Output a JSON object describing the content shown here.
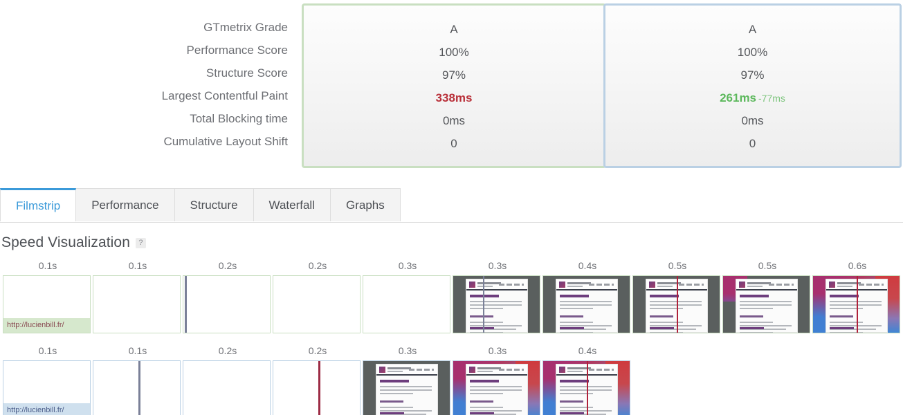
{
  "summary": {
    "metric_labels": [
      "GTmetrix Grade",
      "Performance Score",
      "Structure Score",
      "Largest Contentful Paint",
      "Total Blocking time",
      "Cumulative Layout Shift"
    ],
    "cards": [
      {
        "accent": "#c9dfc1",
        "values": [
          {
            "text": "A",
            "state": "normal",
            "delta": ""
          },
          {
            "text": "100%",
            "state": "normal",
            "delta": ""
          },
          {
            "text": "97%",
            "state": "normal",
            "delta": ""
          },
          {
            "text": "338ms",
            "state": "bad",
            "delta": ""
          },
          {
            "text": "0ms",
            "state": "normal",
            "delta": ""
          },
          {
            "text": "0",
            "state": "normal",
            "delta": ""
          }
        ]
      },
      {
        "accent": "#bad0e4",
        "values": [
          {
            "text": "A",
            "state": "normal",
            "delta": ""
          },
          {
            "text": "100%",
            "state": "normal",
            "delta": ""
          },
          {
            "text": "97%",
            "state": "normal",
            "delta": ""
          },
          {
            "text": "261ms",
            "state": "good",
            "delta": "-77ms"
          },
          {
            "text": "0ms",
            "state": "normal",
            "delta": ""
          },
          {
            "text": "0",
            "state": "normal",
            "delta": ""
          }
        ]
      }
    ]
  },
  "tabs": [
    {
      "label": "Filmstrip",
      "active": true
    },
    {
      "label": "Performance",
      "active": false
    },
    {
      "label": "Structure",
      "active": false
    },
    {
      "label": "Waterfall",
      "active": false
    },
    {
      "label": "Graphs",
      "active": false
    }
  ],
  "section": {
    "title": "Speed Visualization",
    "help_icon": "question-mark-icon",
    "help_label": "?"
  },
  "filmstrip": {
    "rows": [
      {
        "accent": "#c9dfc1",
        "url": "http://lucienbill.fr/",
        "frames": [
          {
            "time": "0.1s",
            "state": "blank",
            "scrub": null
          },
          {
            "time": "0.1s",
            "state": "blank",
            "scrub": null
          },
          {
            "time": "0.2s",
            "state": "blank",
            "scrub": "left-gray"
          },
          {
            "time": "0.2s",
            "state": "blank",
            "scrub": null
          },
          {
            "time": "0.3s",
            "state": "blank",
            "scrub": null
          },
          {
            "time": "0.3s",
            "state": "rendered",
            "scrub": "gray"
          },
          {
            "time": "0.4s",
            "state": "rendered",
            "scrub": null
          },
          {
            "time": "0.5s",
            "state": "rendered",
            "scrub": "red"
          },
          {
            "time": "0.5s",
            "state": "partial",
            "scrub": null
          },
          {
            "time": "0.6s",
            "state": "loaded",
            "scrub": "red"
          }
        ]
      },
      {
        "accent": "#bad0e4",
        "url": "http://lucienbill.fr/",
        "frames": [
          {
            "time": "0.1s",
            "state": "blank",
            "scrub": null
          },
          {
            "time": "0.1s",
            "state": "blank",
            "scrub": "gray"
          },
          {
            "time": "0.2s",
            "state": "blank",
            "scrub": null
          },
          {
            "time": "0.2s",
            "state": "blank",
            "scrub": "red"
          },
          {
            "time": "0.3s",
            "state": "rendered",
            "scrub": null
          },
          {
            "time": "0.3s",
            "state": "loaded",
            "scrub": null
          },
          {
            "time": "0.4s",
            "state": "loaded",
            "scrub": "red"
          }
        ]
      }
    ]
  }
}
